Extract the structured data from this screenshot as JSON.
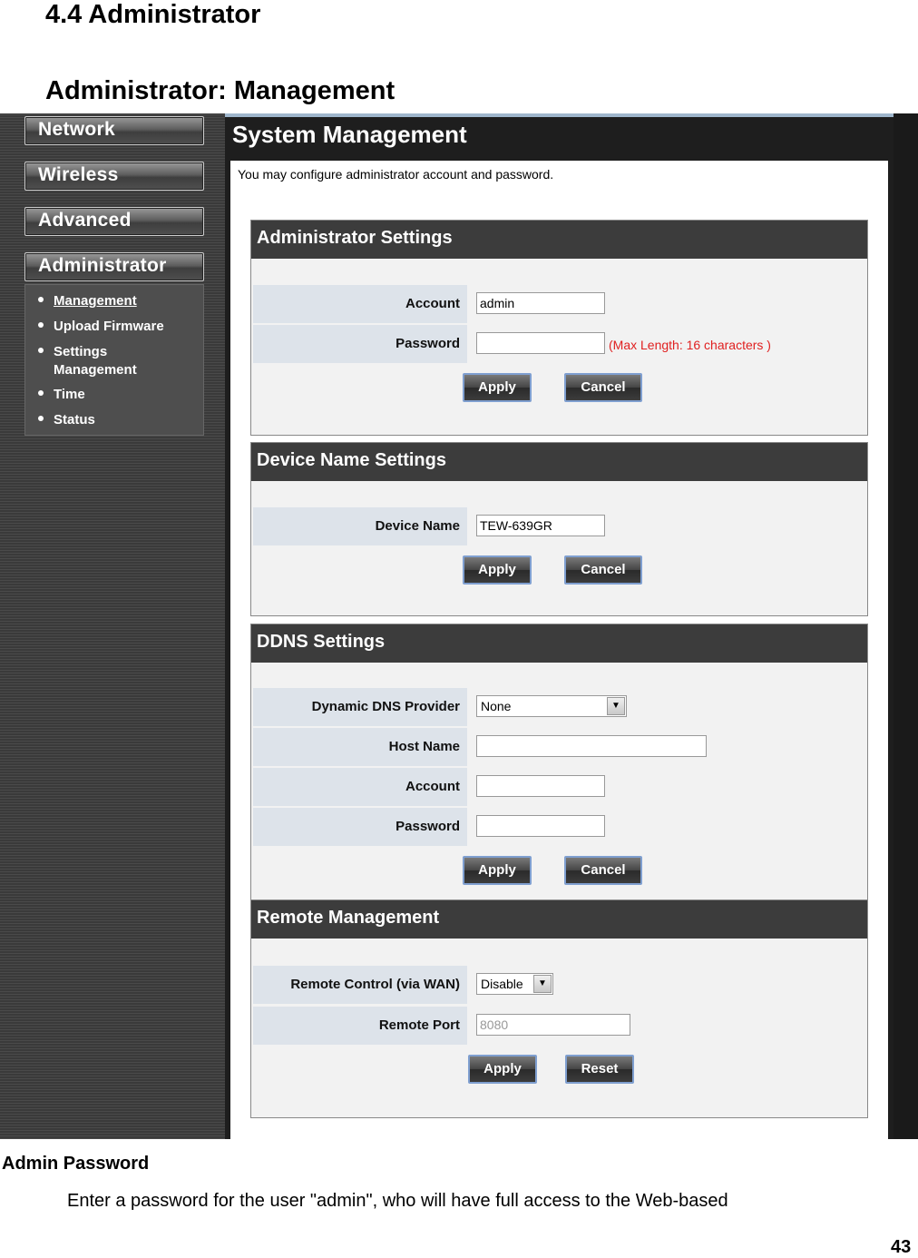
{
  "document": {
    "section_heading": "4.4 Administrator",
    "sub_heading": "Administrator: Management",
    "field_label": "Admin Password",
    "field_description": "Enter a password for the user \"admin\", who will have full access to the Web-based",
    "page_number": "43"
  },
  "sidebar": {
    "nav": [
      {
        "label": "Network"
      },
      {
        "label": "Wireless"
      },
      {
        "label": "Advanced"
      },
      {
        "label": "Administrator"
      }
    ],
    "submenu": [
      {
        "label": "Management",
        "active": true
      },
      {
        "label": "Upload Firmware"
      },
      {
        "label": "Settings Management"
      },
      {
        "label": "Time"
      },
      {
        "label": "Status"
      }
    ]
  },
  "main": {
    "title": "System Management",
    "intro": "You may configure administrator account and password.",
    "admin_settings": {
      "heading": "Administrator Settings",
      "account_label": "Account",
      "account_value": "admin",
      "password_label": "Password",
      "password_value": "",
      "password_note": "(Max Length:  16 characters )",
      "apply": "Apply",
      "cancel": "Cancel"
    },
    "device_name_settings": {
      "heading": "Device Name Settings",
      "device_name_label": "Device Name",
      "device_name_value": "TEW-639GR",
      "apply": "Apply",
      "cancel": "Cancel"
    },
    "ddns_settings": {
      "heading": "DDNS Settings",
      "provider_label": "Dynamic DNS Provider",
      "provider_value": "None",
      "host_label": "Host Name",
      "host_value": "",
      "account_label": "Account",
      "account_value": "",
      "password_label": "Password",
      "password_value": "",
      "apply": "Apply",
      "cancel": "Cancel"
    },
    "remote_management": {
      "heading": "Remote Management",
      "remote_control_label": "Remote Control (via WAN)",
      "remote_control_value": "Disable",
      "remote_port_label": "Remote Port",
      "remote_port_value": "8080",
      "apply": "Apply",
      "reset": "Reset"
    }
  },
  "colors": {
    "note_red": "#e02020",
    "header_dark": "#3c3c3c",
    "label_bg": "#dde3ea",
    "button_border": "#7f9fd0"
  }
}
